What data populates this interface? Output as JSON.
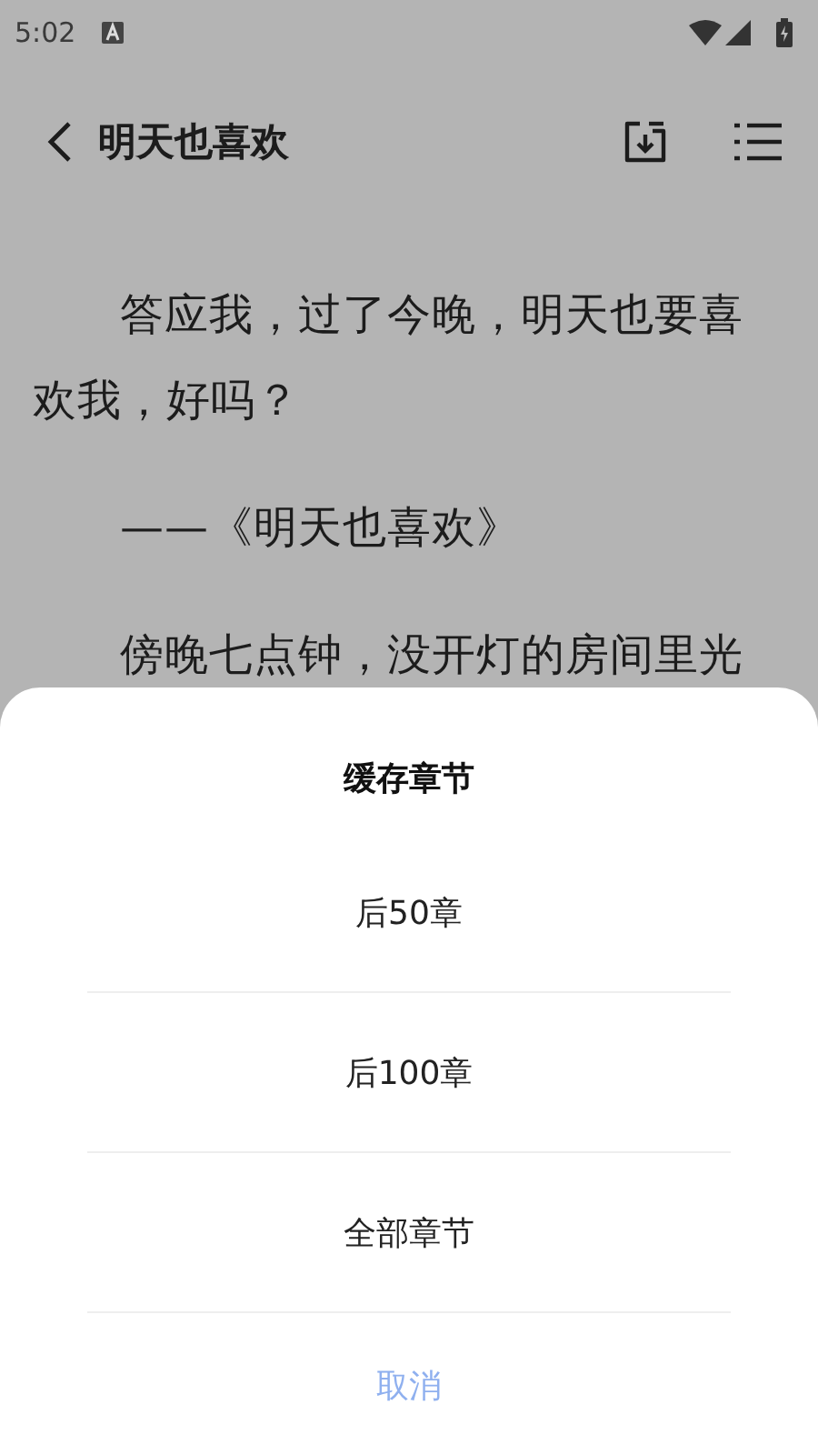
{
  "status_bar": {
    "time": "5:02"
  },
  "header": {
    "title": "明天也喜欢"
  },
  "content": {
    "paragraphs": [
      "答应我，过了今晚，明天也要喜欢我，好吗？",
      "——《明天也喜欢》",
      "傍晚七点钟，没开灯的房间里光"
    ]
  },
  "sheet": {
    "title": "缓存章节",
    "options": [
      "后50章",
      "后100章",
      "全部章节"
    ],
    "cancel": "取消"
  }
}
